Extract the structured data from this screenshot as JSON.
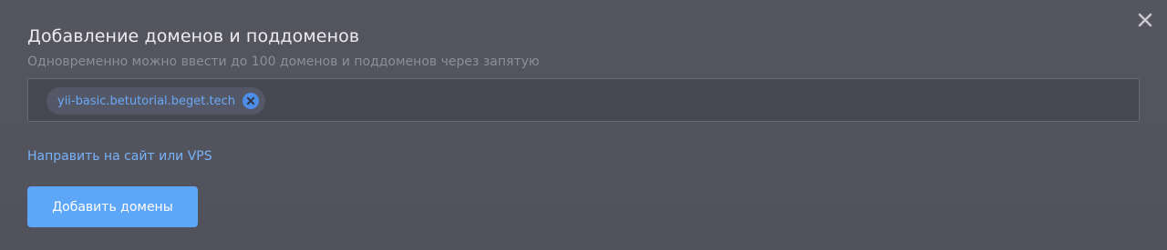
{
  "modal": {
    "title": "Добавление доменов и поддоменов",
    "subtitle": "Одновременно можно ввести до 100 доменов и поддоменов через запятую",
    "close_icon": "close-icon"
  },
  "domain_input": {
    "tags": [
      {
        "label": "yii-basic.betutorial.beget.tech",
        "remove_icon": "remove-circle-icon"
      }
    ]
  },
  "redirect_link": "Направить на сайт или VPS",
  "submit_button": "Добавить домены",
  "colors": {
    "background": "#53535d",
    "accent": "#5ea6f7",
    "link": "#78b2f8",
    "tag_text": "#6aa8f7"
  }
}
